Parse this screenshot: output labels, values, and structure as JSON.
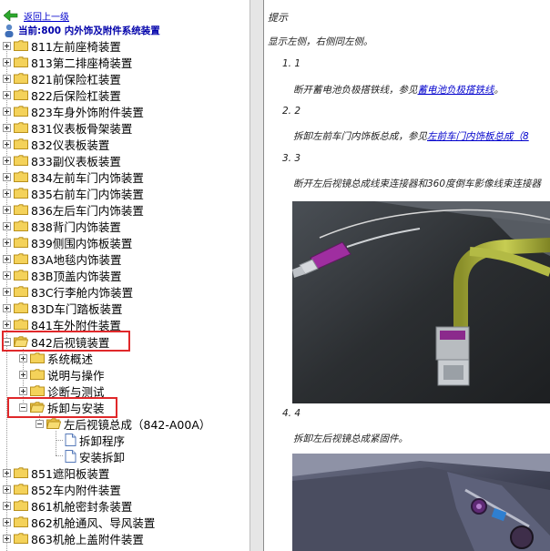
{
  "tree": {
    "back_label": "返回上一级",
    "current_label": "当前:800 内外饰及附件系统装置",
    "items": [
      {
        "label": "811左前座椅装置"
      },
      {
        "label": "813第二排座椅装置"
      },
      {
        "label": "821前保险杠装置"
      },
      {
        "label": "822后保险杠装置"
      },
      {
        "label": "823车身外饰附件装置"
      },
      {
        "label": "831仪表板骨架装置"
      },
      {
        "label": "832仪表板装置"
      },
      {
        "label": "833副仪表板装置"
      },
      {
        "label": "834左前车门内饰装置"
      },
      {
        "label": "835右前车门内饰装置"
      },
      {
        "label": "836左后车门内饰装置"
      },
      {
        "label": "838背门内饰装置"
      },
      {
        "label": "839侧围内饰板装置"
      },
      {
        "label": "83A地毯内饰装置"
      },
      {
        "label": "83B顶盖内饰装置"
      },
      {
        "label": "83C行李舱内饰装置"
      },
      {
        "label": "83D车门踏板装置"
      },
      {
        "label": "841车外附件装置"
      }
    ],
    "expanded_item": {
      "label": "842后视镜装置"
    },
    "children": [
      {
        "label": "系统概述"
      },
      {
        "label": "说明与操作"
      },
      {
        "label": "诊断与测试"
      }
    ],
    "expanded_child": {
      "label": "拆卸与安装"
    },
    "sub_node": {
      "label": "左后视镜总成（842-A00A）"
    },
    "docs": [
      {
        "label": "拆卸程序"
      },
      {
        "label": "安装拆卸"
      }
    ],
    "after_items": [
      {
        "label": "851遮阳板装置"
      },
      {
        "label": "852车内附件装置"
      },
      {
        "label": "861机舱密封条装置"
      },
      {
        "label": "862机舱通风、导风装置"
      },
      {
        "label": "863机舱上盖附件装置"
      }
    ]
  },
  "content": {
    "tip_title": "提示",
    "tip_text": "显示左侧，右侧同左侧。",
    "steps": [
      {
        "num": "1. 1",
        "text": "断开蓄电池负极搭铁线，参见",
        "link": "蓄电池负极搭铁线",
        "suffix": "。"
      },
      {
        "num": "2. 2",
        "text": "拆卸左前车门内饰板总成，参见",
        "link": "左前车门内饰板总成（8",
        "suffix": ""
      },
      {
        "num": "3. 3",
        "text": "断开左后视镜总成线束连接器和360度倒车影像线束连接器",
        "link": "",
        "suffix": ""
      },
      {
        "num": "4. 4",
        "text": "拆卸左后视镜总成紧固件。",
        "link": "",
        "suffix": ""
      }
    ]
  },
  "colors": {
    "highlight": "#e0282a",
    "link": "#0000cc",
    "folder": "#f4d25a"
  }
}
